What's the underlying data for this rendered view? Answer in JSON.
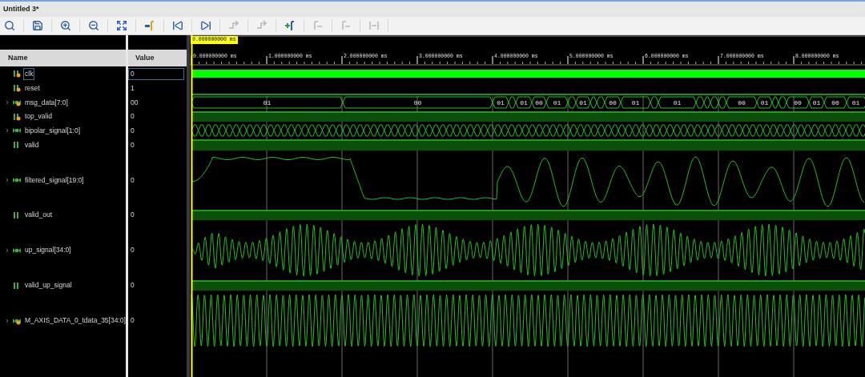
{
  "window": {
    "title": "Untitled 3*"
  },
  "toolbar": [
    {
      "kind": "search",
      "disabled": false
    },
    {
      "kind": "save",
      "disabled": false
    },
    {
      "kind": "zoom-in",
      "disabled": false
    },
    {
      "kind": "zoom-out",
      "disabled": false
    },
    {
      "kind": "fit",
      "disabled": false
    },
    {
      "kind": "to-cursor",
      "disabled": false
    },
    {
      "kind": "first",
      "disabled": false
    },
    {
      "kind": "last",
      "disabled": false
    },
    {
      "kind": "prev-edge",
      "disabled": true
    },
    {
      "kind": "next-edge",
      "disabled": true
    },
    {
      "kind": "add-marker",
      "disabled": false
    },
    {
      "kind": "prev-marker",
      "disabled": true
    },
    {
      "kind": "next-marker",
      "disabled": true
    },
    {
      "kind": "swap",
      "disabled": true
    }
  ],
  "columns": {
    "name": "Name",
    "value": "Value"
  },
  "cursor": {
    "time": "0.000000000 ms"
  },
  "ruler": [
    "0.000000000 ms",
    "1.000000000 ms",
    "2.000000000 ms",
    "3.000000000 ms",
    "4.000000000 ms",
    "5.000000000 ms",
    "6.000000000 ms",
    "7.000000000 ms",
    "8.000000000 ms"
  ],
  "signals": [
    {
      "name": "clk",
      "value": "0",
      "kind": "clock",
      "input": true,
      "expandable": false,
      "selected": true
    },
    {
      "name": "reset",
      "value": "1",
      "kind": "low",
      "input": true,
      "expandable": false,
      "selected": false
    },
    {
      "name": "msg_data[7:0]",
      "value": "00",
      "kind": "bus",
      "input": true,
      "expandable": true,
      "selected": false,
      "bus_labels": [
        "01",
        "00",
        "01",
        "01",
        "00",
        "01",
        "01",
        "00",
        "01",
        "01",
        "00",
        "01",
        "00",
        "01",
        "00",
        "01"
      ]
    },
    {
      "name": "top_valid",
      "value": "0",
      "kind": "level",
      "input": true,
      "expandable": false,
      "selected": false
    },
    {
      "name": "bipolar_signal[1:0]",
      "value": "0",
      "kind": "dense",
      "input": false,
      "expandable": true,
      "selected": false
    },
    {
      "name": "valid",
      "value": "0",
      "kind": "level",
      "input": false,
      "expandable": false,
      "selected": false
    },
    {
      "name": "filtered_signal[19:0]",
      "value": "0",
      "kind": "filtered",
      "input": false,
      "expandable": true,
      "selected": false
    },
    {
      "name": "valid_out",
      "value": "0",
      "kind": "level",
      "input": false,
      "expandable": false,
      "selected": false
    },
    {
      "name": "up_signal[34:0]",
      "value": "0",
      "kind": "modulated",
      "input": false,
      "expandable": true,
      "selected": false
    },
    {
      "name": "valid_up_signal",
      "value": "0",
      "kind": "level",
      "input": false,
      "expandable": false,
      "selected": false
    },
    {
      "name": "M_AXIS_DATA_0_tdata_35[34:0]",
      "value": "0",
      "kind": "carrier",
      "input": true,
      "expandable": true,
      "selected": false
    }
  ]
}
